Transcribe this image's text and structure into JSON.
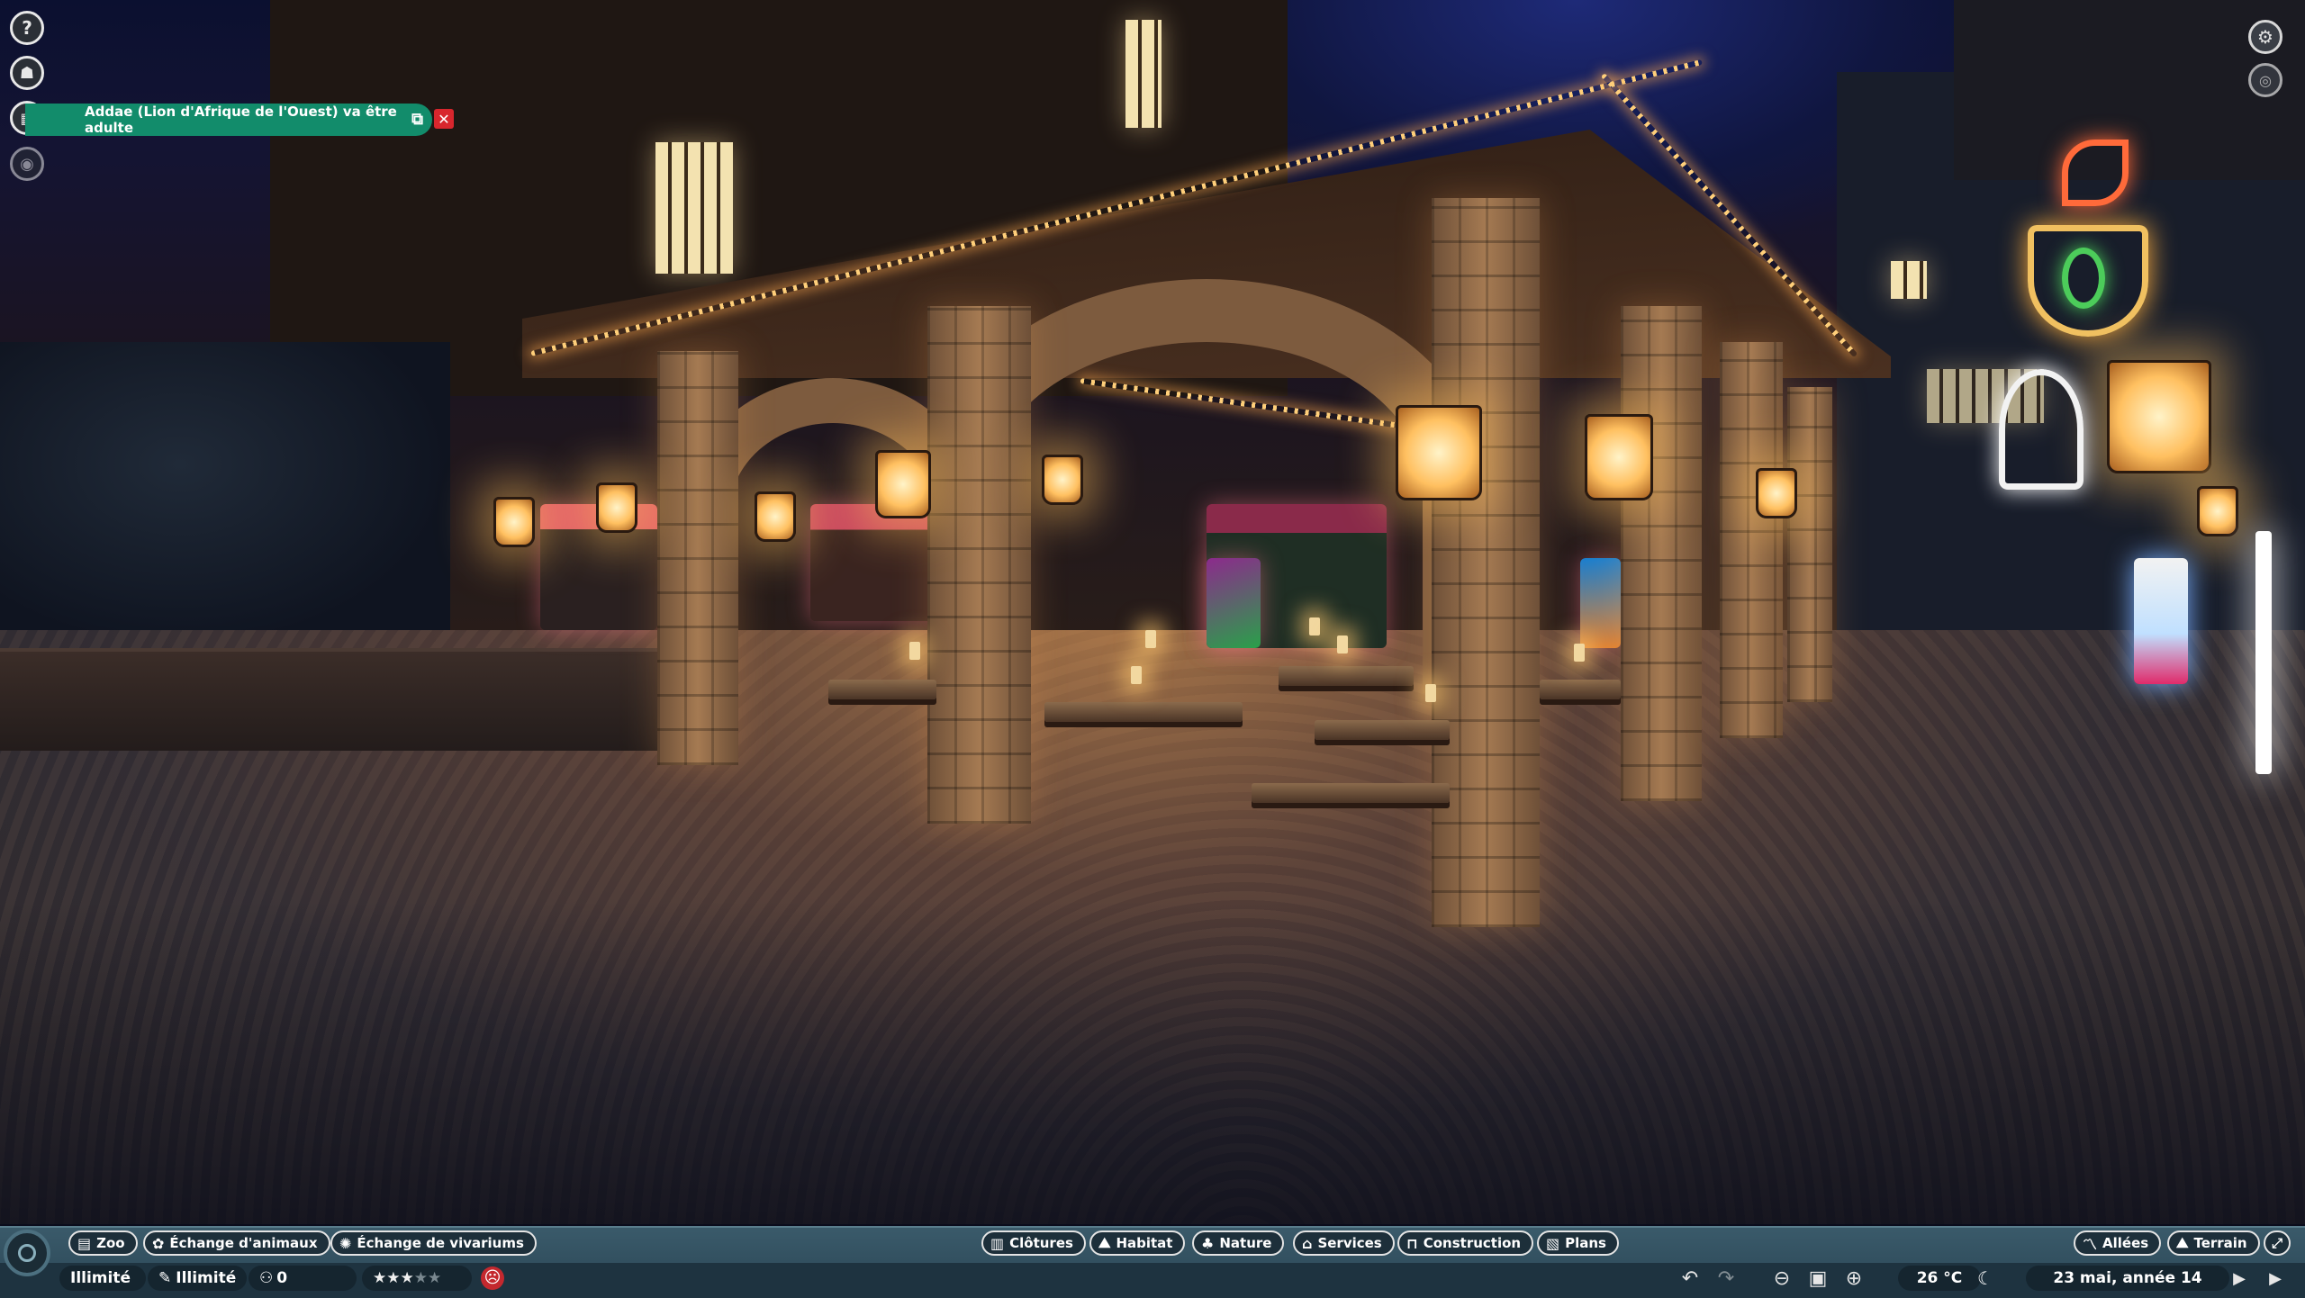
{
  "notification": {
    "text": "Addae (Lion d'Afrique de l'Ouest) va être adulte",
    "open_icon": "external-link-icon",
    "close_icon": "close-icon",
    "color": "#128c6b"
  },
  "left_toolbar": {
    "help_icon": "help-icon",
    "profile_icon": "zoo-profile-icon",
    "calendar_icon": "calendar-icon",
    "view_icon": "eye-icon"
  },
  "top_right": {
    "settings_icon": "gear-icon",
    "camera_icon": "camera-view-icon"
  },
  "hud": {
    "left_tabs": [
      {
        "label": "Zoo",
        "icon": "zoo-icon"
      },
      {
        "label": "Échange d'animaux",
        "icon": "paw-icon"
      },
      {
        "label": "Échange de vivariums",
        "icon": "bug-icon"
      }
    ],
    "center_tabs": [
      {
        "label": "Clôtures",
        "icon": "fence-icon"
      },
      {
        "label": "Habitat",
        "icon": "habitat-icon"
      },
      {
        "label": "Nature",
        "icon": "tree-icon"
      },
      {
        "label": "Services",
        "icon": "shop-icon"
      },
      {
        "label": "Construction",
        "icon": "construction-icon"
      },
      {
        "label": "Plans",
        "icon": "blueprint-icon"
      }
    ],
    "right_tabs": [
      {
        "label": "Allées",
        "icon": "path-icon"
      },
      {
        "label": "Terrain",
        "icon": "terrain-icon"
      }
    ],
    "money": "Illimité",
    "research": "Illimité",
    "guests": "0",
    "rating_stars": 3,
    "rating_max": 5,
    "temperature": "26 °C",
    "date": "23 mai, année 14"
  }
}
